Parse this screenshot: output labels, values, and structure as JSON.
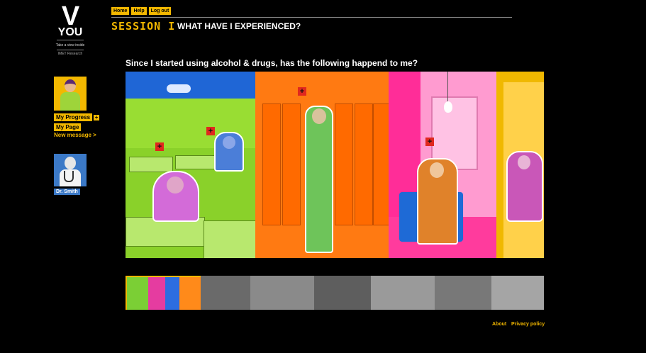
{
  "logo": {
    "letter": "V",
    "word": "YOU",
    "tagline": "Take a view inside",
    "org": "IMET Research"
  },
  "nav": {
    "home": "Home",
    "help": "Help",
    "logout": "Log out"
  },
  "session": {
    "label": "SESSION",
    "number": "I",
    "title": "WHAT HAVE I EXPERIENCED?"
  },
  "sidebar": {
    "my_progress": "My Progress",
    "my_progress_plus": "+",
    "my_page": "My Page",
    "new_message": "New message >",
    "doctor": "Dr. Smith"
  },
  "question": "Since I started using alcohol & drugs, has the following happend to me?",
  "hotspot_symbol": "+",
  "footer": {
    "about": "About",
    "privacy": "Privacy policy"
  },
  "colors": {
    "accent": "#f3b800",
    "hotspot": "#e0281e",
    "doctor_blue": "#3b79c7"
  }
}
